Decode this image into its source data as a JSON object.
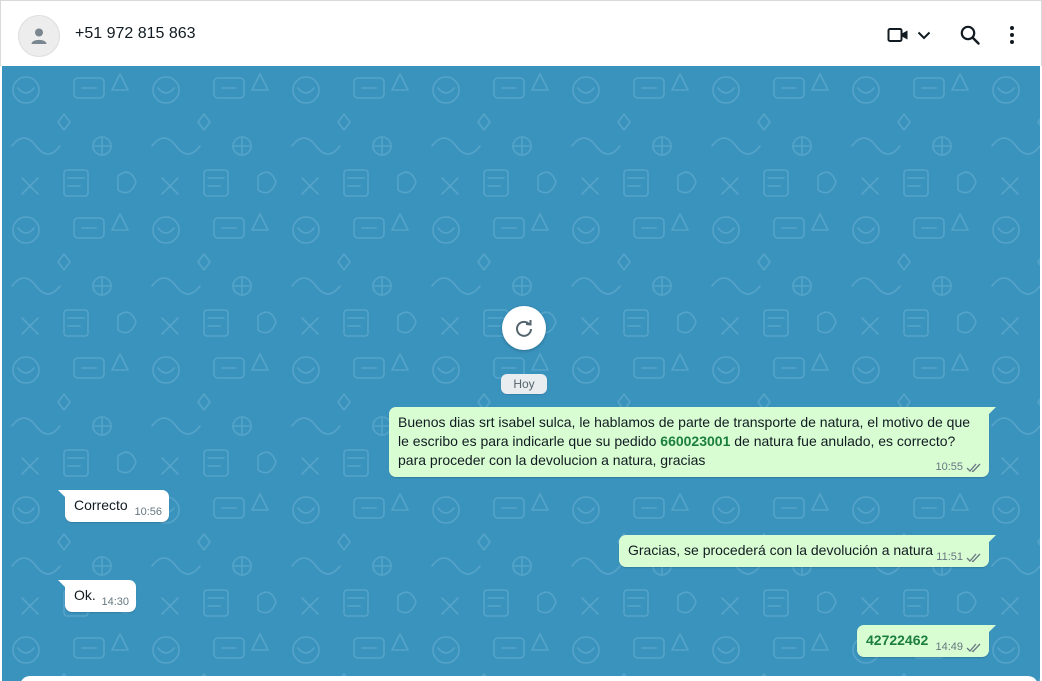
{
  "header": {
    "contact_name": "+51 972 815 863",
    "icons": [
      "person-icon",
      "video-call-icon",
      "chevron-down-icon",
      "search-icon",
      "more-options-icon"
    ]
  },
  "chat": {
    "date_label": "Hoy",
    "colors": {
      "wallpaper": "#3a93bd",
      "outgoing_bubble": "#d9fdd3",
      "incoming_bubble": "#ffffff",
      "highlight": "#1a7f3c"
    },
    "messages": [
      {
        "direction": "outgoing",
        "line1": "Buenos dias srt isabel sulca, le hablamos de parte de transporte de natura, el motivo de que",
        "line2_before": "le escribo es para indicarle que su pedido ",
        "line2_bold": "660023001",
        "line2_after": " de natura fue anulado, es correcto?",
        "line3": "para proceder con la devolucion a natura, gracias",
        "time": "10:55",
        "status": "read"
      },
      {
        "direction": "incoming",
        "text": "Correcto",
        "time": "10:56"
      },
      {
        "direction": "outgoing",
        "text": "Gracias, se procederá con la devolución a natura",
        "time": "11:51",
        "status": "read"
      },
      {
        "direction": "incoming",
        "text": "Ok.",
        "time": "14:30"
      },
      {
        "direction": "outgoing",
        "text": "42722462",
        "time": "14:49",
        "status": "read"
      }
    ]
  }
}
